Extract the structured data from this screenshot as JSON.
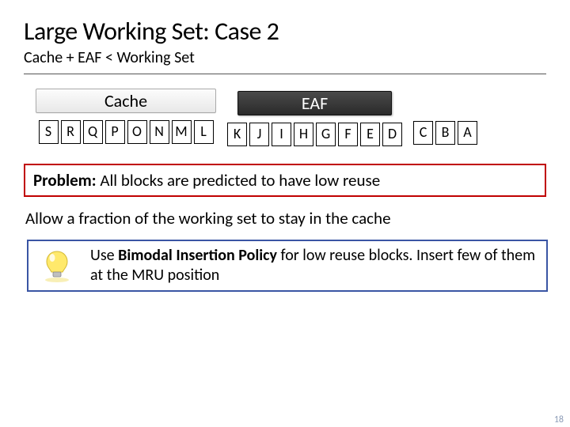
{
  "title": "Large Working Set: Case 2",
  "subtitle": "Cache + EAF < Working Set",
  "cache_label": "Cache",
  "eaf_label": "EAF",
  "cache_cells": [
    "S",
    "R",
    "Q",
    "P",
    "O",
    "N",
    "M",
    "L"
  ],
  "eaf_cells": [
    "K",
    "J",
    "I",
    "H",
    "G",
    "F",
    "E",
    "D"
  ],
  "extra_cells": [
    "C",
    "B",
    "A"
  ],
  "problem_label": "Problem:",
  "problem_text": "All blocks are predicted to have low reuse",
  "allow_text": " Allow a fraction of the working set to stay in the cache",
  "tip_pre": "Use ",
  "tip_bold": "Bimodal Insertion Policy ",
  "tip_rest": "for low reuse blocks. Insert few of them at the MRU position",
  "page_number": "18"
}
